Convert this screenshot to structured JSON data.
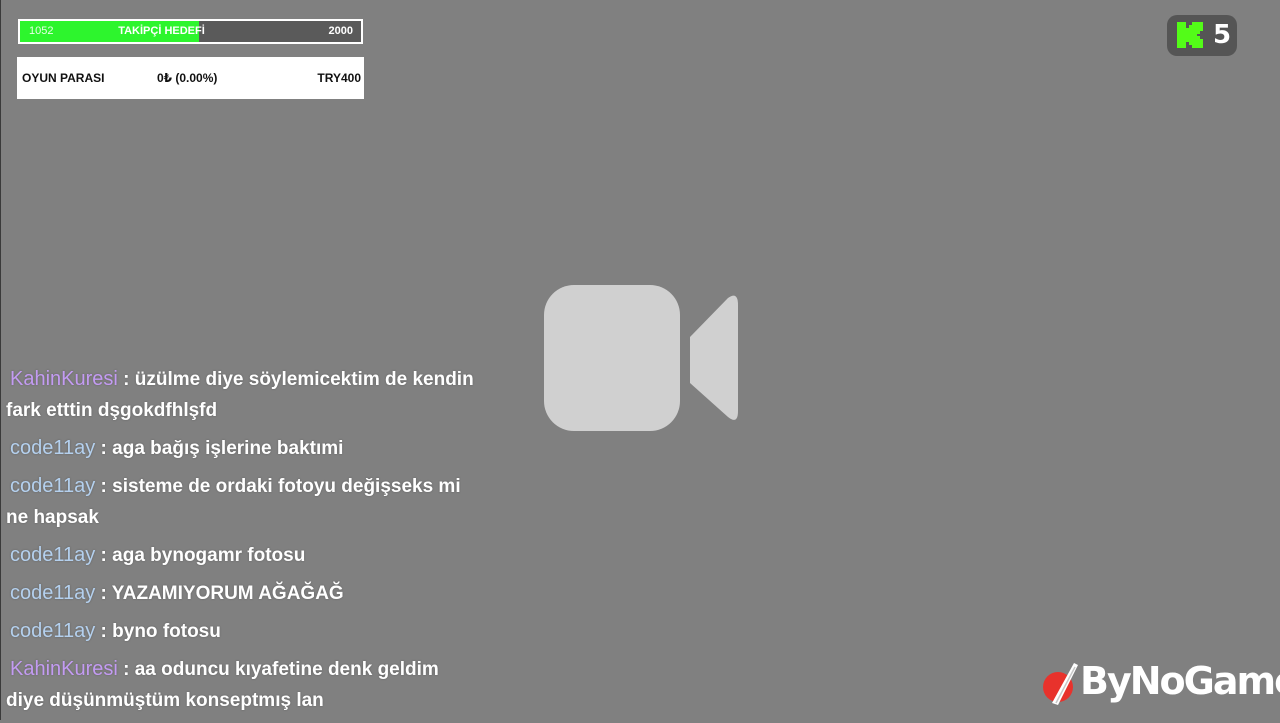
{
  "goal": {
    "current": "1052",
    "title": "TAKİPÇİ HEDEFİ",
    "target": "2000",
    "progress_fraction": 0.526
  },
  "money": {
    "label": "OYUN PARASI",
    "value": "0₺ (0.00%)",
    "target": "TRY400"
  },
  "kick": {
    "icon": "kick-logo-icon",
    "count": "5",
    "accent": "#53fc18"
  },
  "camera": {
    "icon": "video-camera-icon",
    "color": "#d0d0d0"
  },
  "chat": [
    {
      "user": "KahinKuresi",
      "color": "#c39bf2",
      "text": ": üzülme diye söylemicektim de kendin fark etttin dşgokdfhlşfd"
    },
    {
      "user": "code11ay",
      "color": "#b4d0ee",
      "text": ": aga bağış işlerine baktımi"
    },
    {
      "user": "code11ay",
      "color": "#b4d0ee",
      "text": ": sisteme de ordaki fotoyu değişseks mi ne hapsak"
    },
    {
      "user": "code11ay",
      "color": "#b4d0ee",
      "text": ": aga bynogamr fotosu"
    },
    {
      "user": "code11ay",
      "color": "#b4d0ee",
      "text": ": YAZAMIYORUM AĞAĞAĞ"
    },
    {
      "user": "code11ay",
      "color": "#b4d0ee",
      "text": ": byno fotosu"
    },
    {
      "user": "KahinKuresi",
      "color": "#c39bf2",
      "text": ": aa oduncu kıyafetine denk geldim diye düşünmüştüm konseptmış lan"
    }
  ],
  "logo": {
    "text": "ByNoGame",
    "icon": "bynogame-logo-icon",
    "accent": "#e8322c"
  }
}
